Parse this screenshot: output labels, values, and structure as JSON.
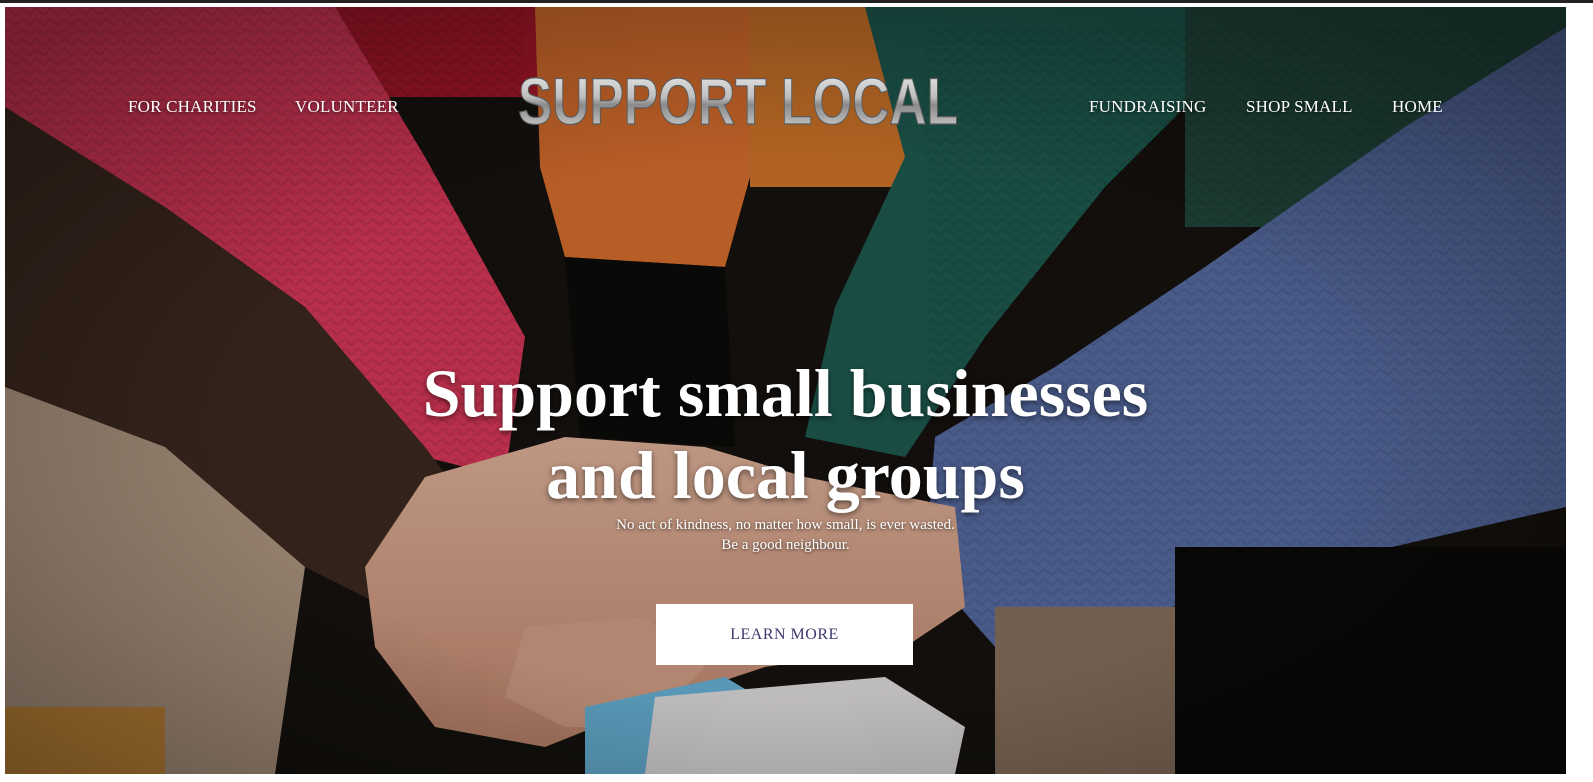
{
  "nav": {
    "left": [
      {
        "label": "FOR CHARITIES"
      },
      {
        "label": "VOLUNTEER"
      }
    ],
    "right": [
      {
        "label": "FUNDRAISING"
      },
      {
        "label": "SHOP SMALL"
      },
      {
        "label": "HOME"
      }
    ]
  },
  "logo": {
    "text": "SUPPORT LOCAL"
  },
  "hero": {
    "headline_line1": "Support small businesses",
    "headline_line2": "and local groups",
    "subtext_line1": "No act of kindness, no matter how small, is ever wasted.",
    "subtext_line2": "Be a good neighbour.",
    "cta_label": "LEARN MORE"
  },
  "colors": {
    "cta_text": "#3c3a6b",
    "cta_background": "#ffffff",
    "nav_text": "#ffffff"
  }
}
